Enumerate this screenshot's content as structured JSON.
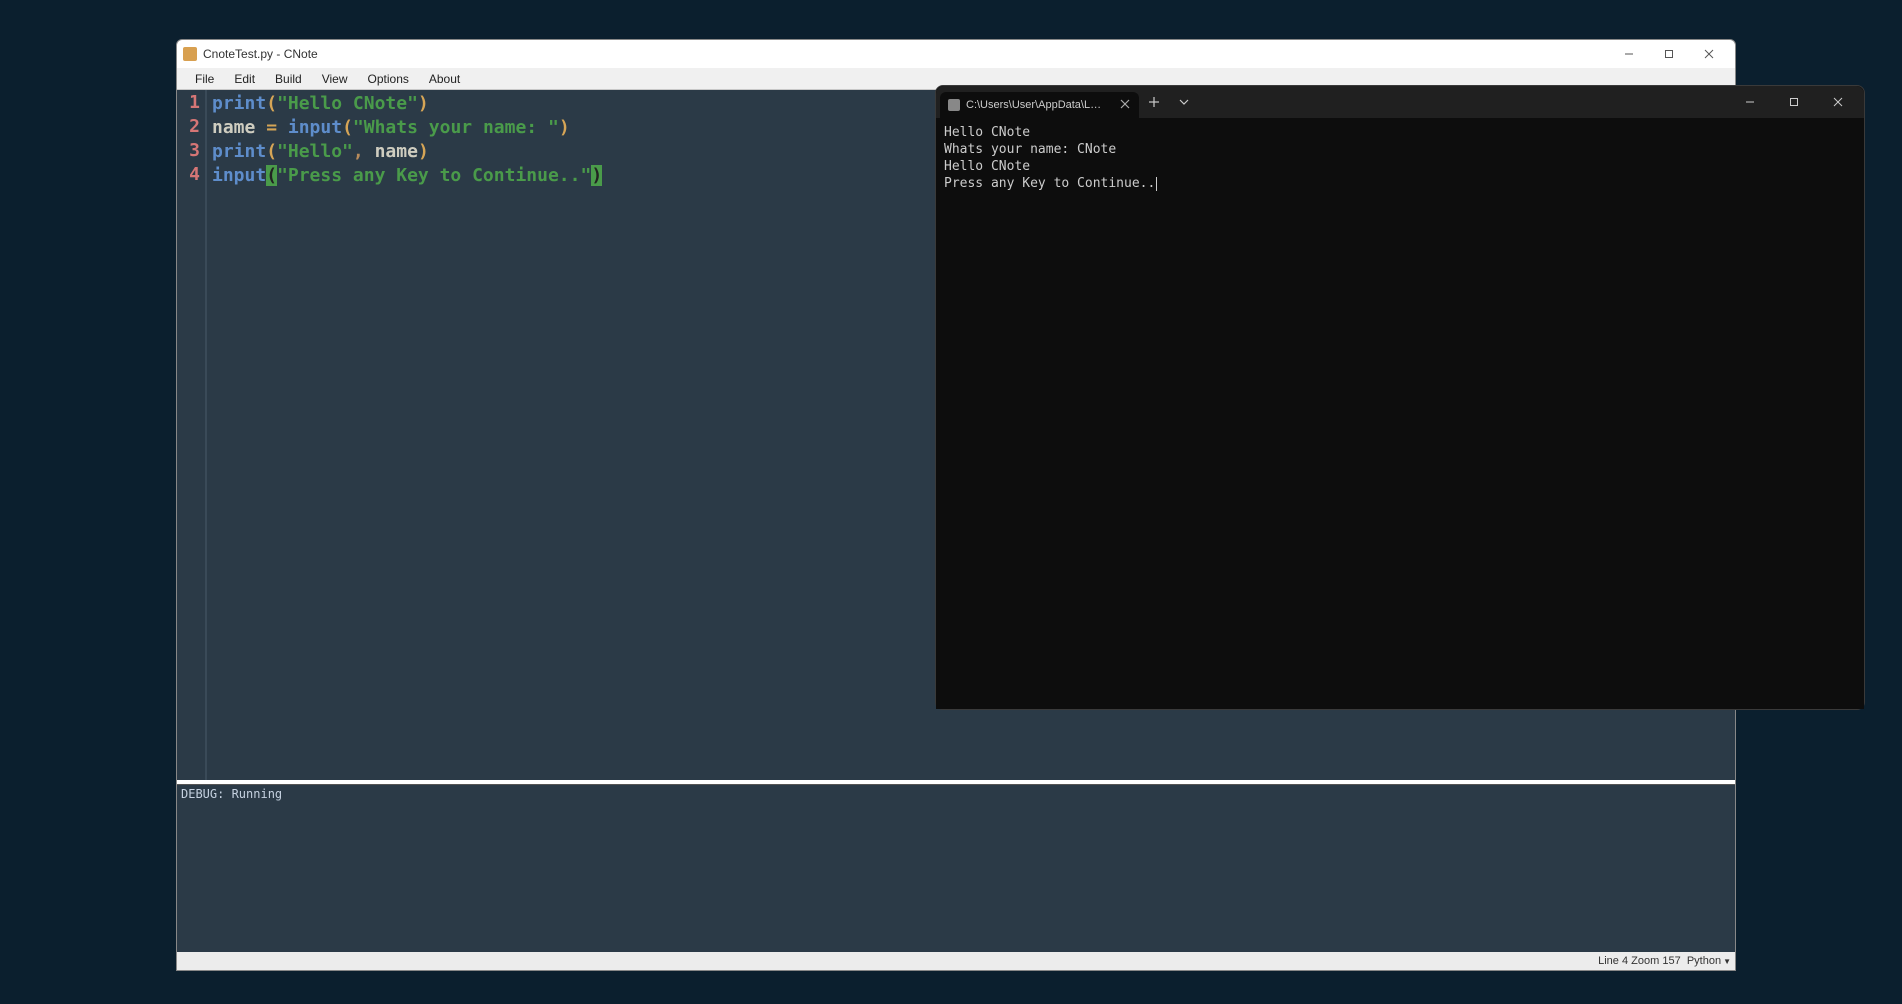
{
  "editor": {
    "title": "CnoteTest.py - CNote",
    "menu": {
      "file": "File",
      "edit": "Edit",
      "build": "Build",
      "view": "View",
      "options": "Options",
      "about": "About"
    },
    "code": {
      "lines": [
        {
          "n": "1",
          "tokens": [
            {
              "t": "print",
              "c": "fn"
            },
            {
              "t": "(",
              "c": "paren"
            },
            {
              "t": "\"Hello CNote\"",
              "c": "str"
            },
            {
              "t": ")",
              "c": "paren"
            }
          ]
        },
        {
          "n": "2",
          "tokens": [
            {
              "t": "name",
              "c": "name"
            },
            {
              "t": " = ",
              "c": "op"
            },
            {
              "t": "input",
              "c": "fn"
            },
            {
              "t": "(",
              "c": "paren"
            },
            {
              "t": "\"Whats your name: \"",
              "c": "str"
            },
            {
              "t": ")",
              "c": "paren"
            }
          ]
        },
        {
          "n": "3",
          "tokens": [
            {
              "t": "print",
              "c": "fn"
            },
            {
              "t": "(",
              "c": "paren"
            },
            {
              "t": "\"Hello\"",
              "c": "str"
            },
            {
              "t": ",",
              "c": "comma"
            },
            {
              "t": " ",
              "c": "name"
            },
            {
              "t": "name",
              "c": "name"
            },
            {
              "t": ")",
              "c": "paren"
            }
          ]
        },
        {
          "n": "4",
          "tokens": [
            {
              "t": "input",
              "c": "fn"
            },
            {
              "t": "(",
              "c": "paren-hl"
            },
            {
              "t": "\"Press any Key to Continue..\"",
              "c": "str"
            },
            {
              "t": ")",
              "c": "paren-hl"
            }
          ]
        }
      ]
    },
    "output": "DEBUG: Running",
    "status": {
      "line": "Line 4",
      "zoom": "Zoom 157",
      "lang": "Python"
    }
  },
  "terminal": {
    "tab_label": "C:\\Users\\User\\AppData\\Local\\P...",
    "output_lines": [
      "Hello CNote",
      "Whats your name: CNote",
      "Hello CNote",
      "Press any Key to Continue.."
    ]
  }
}
